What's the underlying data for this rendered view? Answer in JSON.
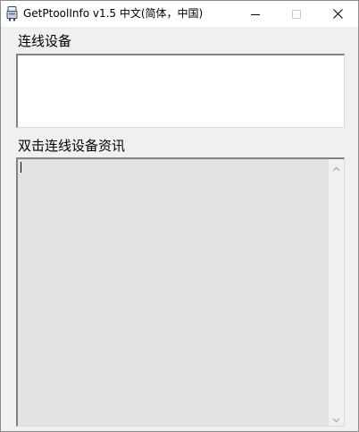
{
  "window": {
    "title": "GetPtoolInfo v1.5 中文(简体，中国)",
    "controls": {
      "minimize": "minimize-icon",
      "maximize": "maximize-icon",
      "close": "close-icon"
    }
  },
  "main": {
    "devices_label": "连线设备",
    "info_label": "双击连线设备资讯",
    "info_text_value": ""
  },
  "colors": {
    "window_bg": "#f0f0f0",
    "titlebar_bg": "#ffffff",
    "textarea_bg": "#e3e3e3"
  }
}
